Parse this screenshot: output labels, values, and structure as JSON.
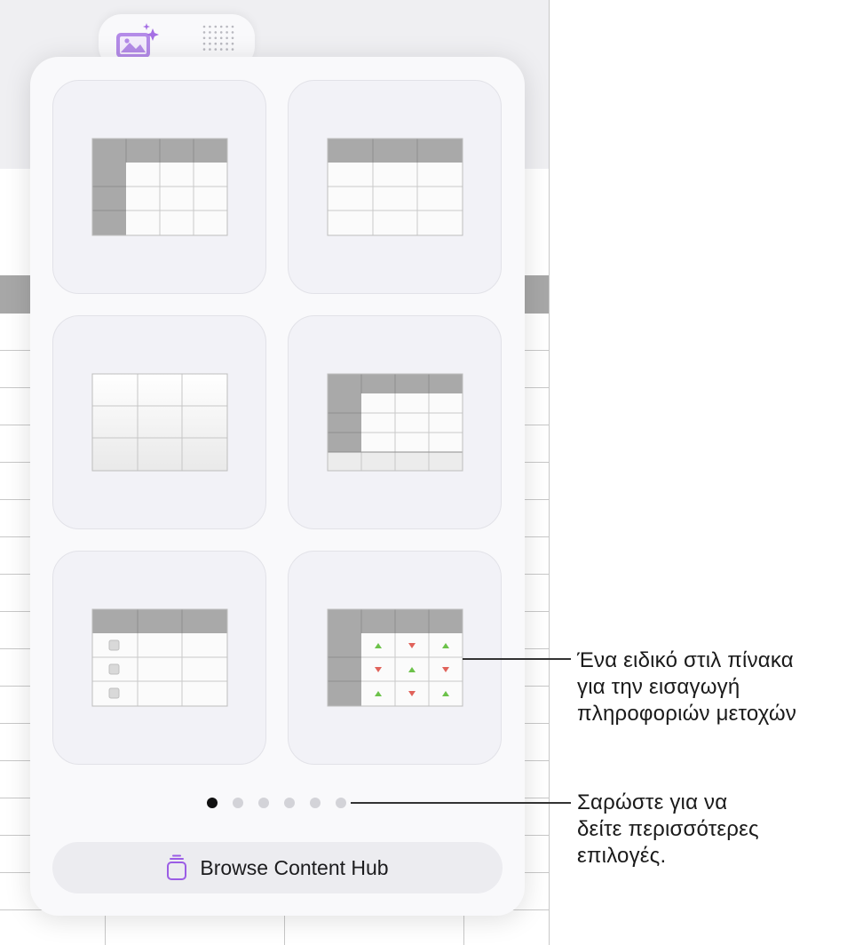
{
  "app": {
    "tabs": [
      {
        "name": "media",
        "icon": "photo-sparkle-icon",
        "active": true
      },
      {
        "name": "tables",
        "icon": "grid-icon",
        "active": false
      }
    ],
    "accent_color": "#9b5de5"
  },
  "table_styles": [
    {
      "id": "header-row-and-column"
    },
    {
      "id": "header-row"
    },
    {
      "id": "plain"
    },
    {
      "id": "header-row-column-footer"
    },
    {
      "id": "checklist"
    },
    {
      "id": "stocks"
    }
  ],
  "pagination": {
    "total": 6,
    "current": 1
  },
  "browse_button": {
    "label": "Browse Content Hub",
    "icon": "content-hub-icon"
  },
  "callouts": {
    "stock": "Ένα ειδικό στιλ πίνακα\nγια την εισαγωγή\nπληροφοριών μετοχών",
    "swipe": "Σαρώστε για να\nδείτε περισσότερες\nεπιλογές."
  },
  "colors": {
    "stock_up": "#6cc24a",
    "stock_down": "#e0625a"
  }
}
